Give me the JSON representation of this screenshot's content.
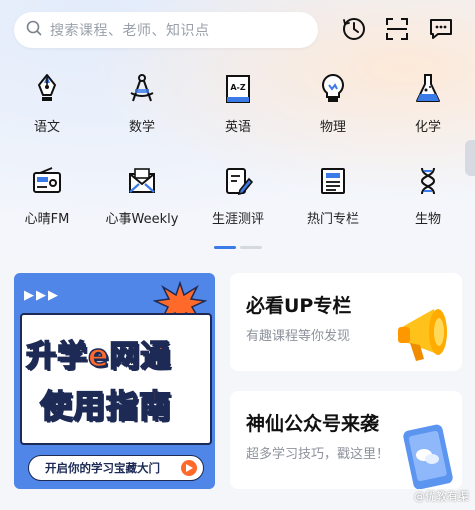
{
  "search": {
    "placeholder": "搜索课程、老师、知识点"
  },
  "top_icons": [
    "history-icon",
    "scan-icon",
    "message-icon"
  ],
  "categories": [
    {
      "label": "语文",
      "icon": "fountain-pen-icon"
    },
    {
      "label": "数学",
      "icon": "compass-icon"
    },
    {
      "label": "英语",
      "icon": "dictionary-icon"
    },
    {
      "label": "物理",
      "icon": "lightbulb-icon"
    },
    {
      "label": "化学",
      "icon": "flask-icon"
    },
    {
      "label": "心晴FM",
      "icon": "radio-icon"
    },
    {
      "label": "心事Weekly",
      "icon": "envelope-icon"
    },
    {
      "label": "生涯测评",
      "icon": "edit-document-icon"
    },
    {
      "label": "热门专栏",
      "icon": "newspaper-icon"
    },
    {
      "label": "生物",
      "icon": "dna-icon"
    }
  ],
  "pager": {
    "active": 0,
    "count": 2
  },
  "banner": {
    "arrows": "▶▶▶",
    "title_line1": "升学e网通",
    "title_line2": "使用指南",
    "cta": "开启你的学习宝藏大门"
  },
  "promos": [
    {
      "title": "必看UP专栏",
      "subtitle": "有趣课程等你发现"
    },
    {
      "title": "神仙公众号来袭",
      "subtitle": "超多学习技巧，戳这里！"
    }
  ],
  "watermark": "@优教有渠",
  "colors": {
    "accent_blue": "#4f86e8",
    "accent_orange": "#ff6a2a",
    "navy": "#1c2a55",
    "icon_blue": "#3b7be8"
  }
}
